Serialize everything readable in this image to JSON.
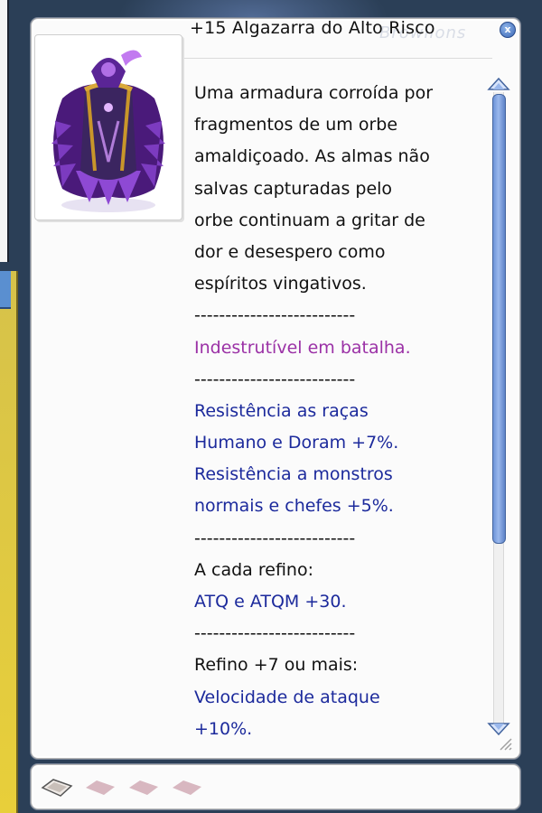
{
  "window": {
    "title": "+15 Algazarra do Alto Risco",
    "close_label": "x",
    "watermark": "Browiions"
  },
  "item_image": {
    "icon": "armor-illustration-icon",
    "colors": {
      "robe": "#6a2a9c",
      "trim": "#c9962a",
      "feathers": "#4a1a7a"
    }
  },
  "description": {
    "lines": [
      {
        "text": "Uma armadura corroída por",
        "color": "black"
      },
      {
        "text": "fragmentos de um orbe",
        "color": "black"
      },
      {
        "text": "amaldiçoado. As almas não",
        "color": "black"
      },
      {
        "text": "salvas capturadas pelo",
        "color": "black"
      },
      {
        "text": "orbe continuam a gritar de",
        "color": "black"
      },
      {
        "text": "dor e desespero como",
        "color": "black"
      },
      {
        "text": "espíritos vingativos.",
        "color": "black"
      },
      {
        "text": "--------------------------",
        "color": "black"
      },
      {
        "text": "Indestrutível em batalha.",
        "color": "purple"
      },
      {
        "text": "--------------------------",
        "color": "black"
      },
      {
        "text": "Resistência as raças",
        "color": "blue"
      },
      {
        "text": "Humano e Doram +7%.",
        "color": "blue"
      },
      {
        "text": "Resistência a monstros",
        "color": "blue"
      },
      {
        "text": "normais e chefes +5%.",
        "color": "blue"
      },
      {
        "text": "--------------------------",
        "color": "black"
      },
      {
        "text": "A cada refino:",
        "color": "black"
      },
      {
        "text": "ATQ e ATQM +30.",
        "color": "blue"
      },
      {
        "text": "--------------------------",
        "color": "black"
      },
      {
        "text": "Refino +7 ou mais:",
        "color": "black"
      },
      {
        "text": "Velocidade de ataque",
        "color": "blue"
      },
      {
        "text": "+10%.",
        "color": "blue"
      }
    ]
  },
  "scrollbar": {
    "up_icon": "scroll-up-arrow-icon",
    "down_icon": "scroll-down-arrow-icon",
    "thumb_fraction": 0.7,
    "position": 0.0
  },
  "card_slots": [
    {
      "icon": "card-slot-filled-icon",
      "state": "filled"
    },
    {
      "icon": "card-slot-empty-icon",
      "state": "empty"
    },
    {
      "icon": "card-slot-empty-icon",
      "state": "empty"
    },
    {
      "icon": "card-slot-empty-icon",
      "state": "empty"
    }
  ],
  "colors": {
    "black": "#111111",
    "purple": "#9b31a6",
    "blue": "#1c2a9c",
    "scroll_accent": "#6d93d8"
  }
}
